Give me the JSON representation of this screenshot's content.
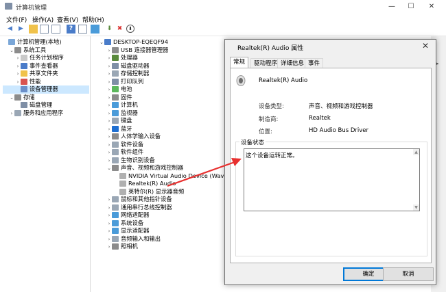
{
  "window": {
    "title": "计算机管理",
    "min": "—",
    "max": "☐",
    "close": "✕"
  },
  "menu": [
    "文件(F)",
    "操作(A)",
    "查看(V)",
    "帮助(H)"
  ],
  "left_tree": [
    {
      "label": "计算机管理(本地)",
      "indent": 0,
      "arrow": "",
      "icon": "#7ba7d8"
    },
    {
      "label": "系统工具",
      "indent": 1,
      "arrow": "⌄",
      "icon": "#8c8c8c"
    },
    {
      "label": "任务计划程序",
      "indent": 2,
      "arrow": "›",
      "icon": "#c9c9c9"
    },
    {
      "label": "事件查看器",
      "indent": 2,
      "arrow": "›",
      "icon": "#4a7cc9"
    },
    {
      "label": "共享文件夹",
      "indent": 2,
      "arrow": "›",
      "icon": "#f0c24b"
    },
    {
      "label": "性能",
      "indent": 2,
      "arrow": "›",
      "icon": "#d9534f"
    },
    {
      "label": "设备管理器",
      "indent": 2,
      "arrow": "",
      "icon": "#6b8fc9",
      "selected": true
    },
    {
      "label": "存储",
      "indent": 1,
      "arrow": "⌄",
      "icon": "#8c8c8c"
    },
    {
      "label": "磁盘管理",
      "indent": 2,
      "arrow": "",
      "icon": "#7f8fa6"
    },
    {
      "label": "服务和应用程序",
      "indent": 1,
      "arrow": "›",
      "icon": "#9aa7b5"
    }
  ],
  "device_tree": [
    {
      "label": "DESKTOP-EQEQF94",
      "indent": 0,
      "arrow": "⌄",
      "icon": "#4a7cc9"
    },
    {
      "label": "USB 连接器管理器",
      "indent": 1,
      "arrow": "›",
      "icon": "#8c8c8c"
    },
    {
      "label": "处理器",
      "indent": 1,
      "arrow": "›",
      "icon": "#5a8a3c"
    },
    {
      "label": "磁盘驱动器",
      "indent": 1,
      "arrow": "›",
      "icon": "#7f8fa6"
    },
    {
      "label": "存储控制器",
      "indent": 1,
      "arrow": "›",
      "icon": "#9aa7b5"
    },
    {
      "label": "打印队列",
      "indent": 1,
      "arrow": "›",
      "icon": "#7f8fa6"
    },
    {
      "label": "电池",
      "indent": 1,
      "arrow": "›",
      "icon": "#5cb85c"
    },
    {
      "label": "固件",
      "indent": 1,
      "arrow": "›",
      "icon": "#8c8c8c"
    },
    {
      "label": "计算机",
      "indent": 1,
      "arrow": "›",
      "icon": "#4a9bd9"
    },
    {
      "label": "监视器",
      "indent": 1,
      "arrow": "›",
      "icon": "#4a9bd9"
    },
    {
      "label": "键盘",
      "indent": 1,
      "arrow": "›",
      "icon": "#9aa7b5"
    },
    {
      "label": "蓝牙",
      "indent": 1,
      "arrow": "›",
      "icon": "#1f6fd1"
    },
    {
      "label": "人体学输入设备",
      "indent": 1,
      "arrow": "›",
      "icon": "#8c8c8c"
    },
    {
      "label": "软件设备",
      "indent": 1,
      "arrow": "›",
      "icon": "#9aa7b5"
    },
    {
      "label": "软件组件",
      "indent": 1,
      "arrow": "›",
      "icon": "#9aa7b5"
    },
    {
      "label": "生物识别设备",
      "indent": 1,
      "arrow": "›",
      "icon": "#9aa7b5"
    },
    {
      "label": "声音、视频和游戏控制器",
      "indent": 1,
      "arrow": "⌄",
      "icon": "#8c8c8c"
    },
    {
      "label": "NVIDIA Virtual Audio Device (Wave Exte",
      "indent": 2,
      "arrow": "",
      "icon": "#b0b0b0"
    },
    {
      "label": "Realtek(R) Audio",
      "indent": 2,
      "arrow": "",
      "icon": "#b0b0b0"
    },
    {
      "label": "英特尔(R) 显示器音频",
      "indent": 2,
      "arrow": "",
      "icon": "#b0b0b0"
    },
    {
      "label": "鼠标和其他指针设备",
      "indent": 1,
      "arrow": "›",
      "icon": "#9aa7b5"
    },
    {
      "label": "通用串行总线控制器",
      "indent": 1,
      "arrow": "›",
      "icon": "#9aa7b5"
    },
    {
      "label": "网络适配器",
      "indent": 1,
      "arrow": "›",
      "icon": "#4a9bd9"
    },
    {
      "label": "系统设备",
      "indent": 1,
      "arrow": "›",
      "icon": "#4a9bd9"
    },
    {
      "label": "显示适配器",
      "indent": 1,
      "arrow": "›",
      "icon": "#4a9bd9"
    },
    {
      "label": "音频输入和输出",
      "indent": 1,
      "arrow": "›",
      "icon": "#9aa7b5"
    },
    {
      "label": "照相机",
      "indent": 1,
      "arrow": "›",
      "icon": "#8c8c8c"
    }
  ],
  "dialog": {
    "title": "Realtek(R) Audio 属性",
    "close": "✕",
    "tabs": [
      "常规",
      "驱动程序",
      "详细信息",
      "事件"
    ],
    "device_name": "Realtek(R) Audio",
    "props": [
      {
        "label": "设备类型:",
        "value": "声音、视频和游戏控制器"
      },
      {
        "label": "制造商:",
        "value": "Realtek"
      },
      {
        "label": "位置:",
        "value": "HD Audio Bus Driver"
      }
    ],
    "status_group": "设备状态",
    "status_text": "这个设备运转正常。",
    "ok": "确定",
    "cancel": "取消"
  },
  "colors": {
    "arrow": "#e8302f",
    "selection": "#cce8ff",
    "default_button_border": "#0078d7"
  }
}
